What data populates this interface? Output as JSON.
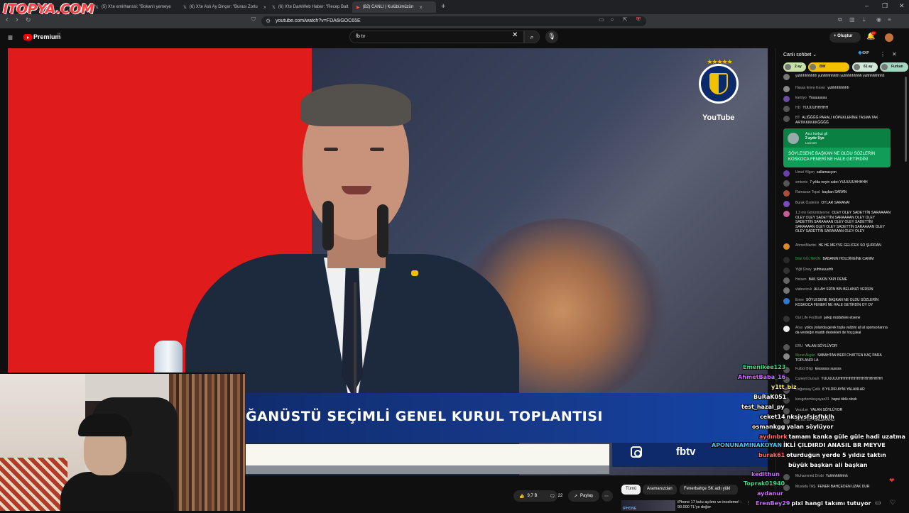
{
  "browser": {
    "watermark": "ITOPYA.COM",
    "tabs": [
      {
        "label": "(5) X'te emirhanssi: \"Bokan'ı yemeye"
      },
      {
        "label": "(6) X'te Aslı Ay Dinçer: \"Burası Zorlu"
      },
      {
        "label": "(6) X'te DarkWeb Haber: \"Recep Balt"
      },
      {
        "label": "(82) CANLI | Kulübümüzün"
      }
    ],
    "new_tab": "+",
    "url": "youtube.com/watch?v=FDA6iGOC65E"
  },
  "youtube": {
    "logo_text": "Premium",
    "logo_tr": "TR",
    "search_value": "fb tv",
    "create_label": "Oluştur",
    "notif_count": "9+"
  },
  "video": {
    "banner_text": "ĞANÜSTÜ SEÇİMLİ GENEL KURUL TOPLANTISI",
    "brand": "fbtv",
    "logo_caption": "YouTube",
    "logo_stars": "★★★★★"
  },
  "actions": {
    "likes": "9,7 B",
    "comments": "22",
    "share": "Paylaş"
  },
  "chips": [
    "Tümü",
    "Aramanızdan",
    "Fenerbahçe SK adlı yükl"
  ],
  "recommendation": {
    "title": "iPhone 17 kutu açılımı ve inceleme! - 90.000 TL'ye değer",
    "thumb_label": "IPHONE"
  },
  "chat": {
    "header": "Canlı sohbet",
    "xp": "0XP",
    "donors": [
      {
        "label": "2 ay",
        "color": "#e3f2c1"
      },
      {
        "label": "BW",
        "color": "#f2c200"
      },
      {
        "label": "61 ay",
        "color": "#cfe8d8"
      },
      {
        "label": "Furkan",
        "color": "#b9e4d0"
      }
    ],
    "messages": [
      {
        "name": "",
        "text": "yuhhhhhhhhh yuhhhhhhhhh yuhhhhhhhhh yuhhhhhhhhh",
        "color": "#777"
      },
      {
        "name": "Hasan Emre Keser",
        "text": "yuhhhhhhhhh",
        "color": "#888"
      },
      {
        "name": "kamiyo",
        "text": "Yuuuuuuuu",
        "color": "#6a4ea0"
      },
      {
        "name": "HD",
        "text": "YUUUUHHHHH",
        "color": "#555"
      },
      {
        "name": "BT",
        "text": "ALİĞĞĞĞ PARALI KÖPEKLERİNE TASMA TAK ARTIKKKKKKĞĞĞĞ",
        "color": "#555"
      },
      {
        "name": "Umut Yilgen",
        "text": "sallamasyon",
        "color": "#6a3fb0"
      },
      {
        "name": "smtsnts",
        "text": "7 yılda neyin sabrı YUUUUUHHHHH",
        "color": "#555"
      },
      {
        "name": "Ramazan Topal",
        "text": "başkan SARAN",
        "color": "#b04a3a"
      },
      {
        "name": "Burak Özdemir",
        "text": "OYLAR SARANA!",
        "color": "#7a4ac0"
      },
      {
        "name": "1.3 mn Görüntülenme",
        "text": "OLEY OLEY SADETTİN SARAAAAN OLEY OLEY SADETTİN SARAAAAN OLEY OLEY SADETTİN SARAAAAN OLEY OLEY SADETTİN SARAAAAN OLEY OLEY SADETTİN SARAAAAN OLEY OLEY SADETTİN SARAAAAN OLEY OLEY",
        "color": "#c85a9a"
      },
      {
        "name": "AhmetMartini",
        "text": "HE HE MEYVE GELİCEK SO ŞURDAN",
        "color": "#d98a2a"
      },
      {
        "name": "Bilal GÜLTEKİN",
        "text": "BABANIN HOLDİNGİNE CANIM",
        "color": "#2a2a2a",
        "green": true
      },
      {
        "name": "Yiğit Üney",
        "text": "yuhhuuuuhh",
        "color": "#333"
      },
      {
        "name": "Heisen",
        "text": "BAK SAKIN YAPI DEME",
        "color": "#666"
      },
      {
        "name": "vlabovicvk",
        "text": "ALLAH SİZİN BİN BELANIZI VERSİN",
        "color": "#777"
      },
      {
        "name": "Emre",
        "text": "SÖYLESENE BAŞKAN NE OLDU SÖZLERİN KOSKOCA FENERİ NE HALE GETİRDİN OY OY",
        "color": "#2a7ad0"
      },
      {
        "name": "Our Life Football",
        "text": "şekip müdahele etsene",
        "color": "#333"
      },
      {
        "name": "Aras",
        "text": "yolcu yolunda gerek topla vallzini ali al sponsorlarına da verdeğın maddi destekleri de hoççakal",
        "color": "#eee"
      },
      {
        "name": "ERU",
        "text": "YALAN SÖYLÜYOR",
        "color": "#555"
      },
      {
        "name": "Murat Akgün",
        "text": "SABAHTAN BERİ CHATTEN KAÇ PARA TOPLANDI LA",
        "color": "#888",
        "green": true
      },
      {
        "name": "Futbol Bilgi",
        "text": "kessssss sussss",
        "color": "#555"
      },
      {
        "name": "Cuneyt Dursun",
        "text": "YUUUUUUHHHHHHHHHHHHHHHHH",
        "color": "#555"
      },
      {
        "name": "Doğansay Çelik",
        "text": "8 YILDIR AYNI YALANLAR",
        "color": "#555"
      },
      {
        "name": "kicsgotemlosyayan31",
        "text": "hepsi öldü olcek",
        "color": "#444"
      },
      {
        "name": "VezzLer",
        "text": "YALAN SÖYLÜYOR",
        "color": "#555"
      },
      {
        "name": "Samet Elif",
        "text": "MACERA ALİ",
        "color": "#555"
      },
      {
        "name": "Muhammed Drobi",
        "text": "Yuhhhhhhhhh",
        "color": "#555"
      },
      {
        "name": "Mustafa TAŞ",
        "text": "FENER BAHÇEDEN UZAK DUR",
        "color": "#555"
      }
    ],
    "superchat": {
      "name": "Azız korkut gli",
      "meta": "2 aydır Üye",
      "sub": "Lacivert",
      "text": "SÖYLESENE BAŞKAN NE OLDU SÖZLERİN KOSKOCA FENERİ NE HALE GETİRDİN!"
    }
  },
  "overlay_chat": [
    {
      "name": "Emenikee123",
      "msg": "",
      "color": "#3ddc84"
    },
    {
      "name": "AhmetBaba_16",
      "msg": "",
      "color": "#c86bff"
    },
    {
      "name": "y1tt_biz",
      "msg": "",
      "color": "#ffee58"
    },
    {
      "name": "BuRaK051",
      "msg": "",
      "color": "#ffffff"
    },
    {
      "name": "test_hazal_py",
      "msg": "",
      "color": "#ffffff"
    },
    {
      "name": "ceket14",
      "msg": "nksjvsfsjsfhklh",
      "color": "#ffffff"
    },
    {
      "name": "osmankgg",
      "msg": "yalan söylüyor",
      "color": "#ffffff"
    },
    {
      "name": "aydınbrk",
      "msg": "tamam kanka güle güle hadi uzatma",
      "color": "#ff6b6b"
    },
    {
      "name": "APONUNAMINAKOYAN",
      "msg": "İKLİ ÇILDIRDI ANASIL BR MEYVE",
      "color": "#4fc3f7"
    },
    {
      "name": "burak61",
      "msg": "oturduğun yerde 5 yıldız taktın",
      "color": "#ff6b6b"
    },
    {
      "name": "",
      "msg": "büyük başkan ali başkan",
      "color": "#ffffff"
    },
    {
      "name": "kedithun",
      "msg": "",
      "color": "#c86bff"
    },
    {
      "name": "Toprak01940",
      "msg": "",
      "color": "#3ddc84"
    },
    {
      "name": "aydanur",
      "msg": "",
      "color": "#c86bff"
    },
    {
      "name": "ErenBey29",
      "msg": "pixi hangi takımı tutuyor",
      "color": "#c86bff"
    }
  ]
}
